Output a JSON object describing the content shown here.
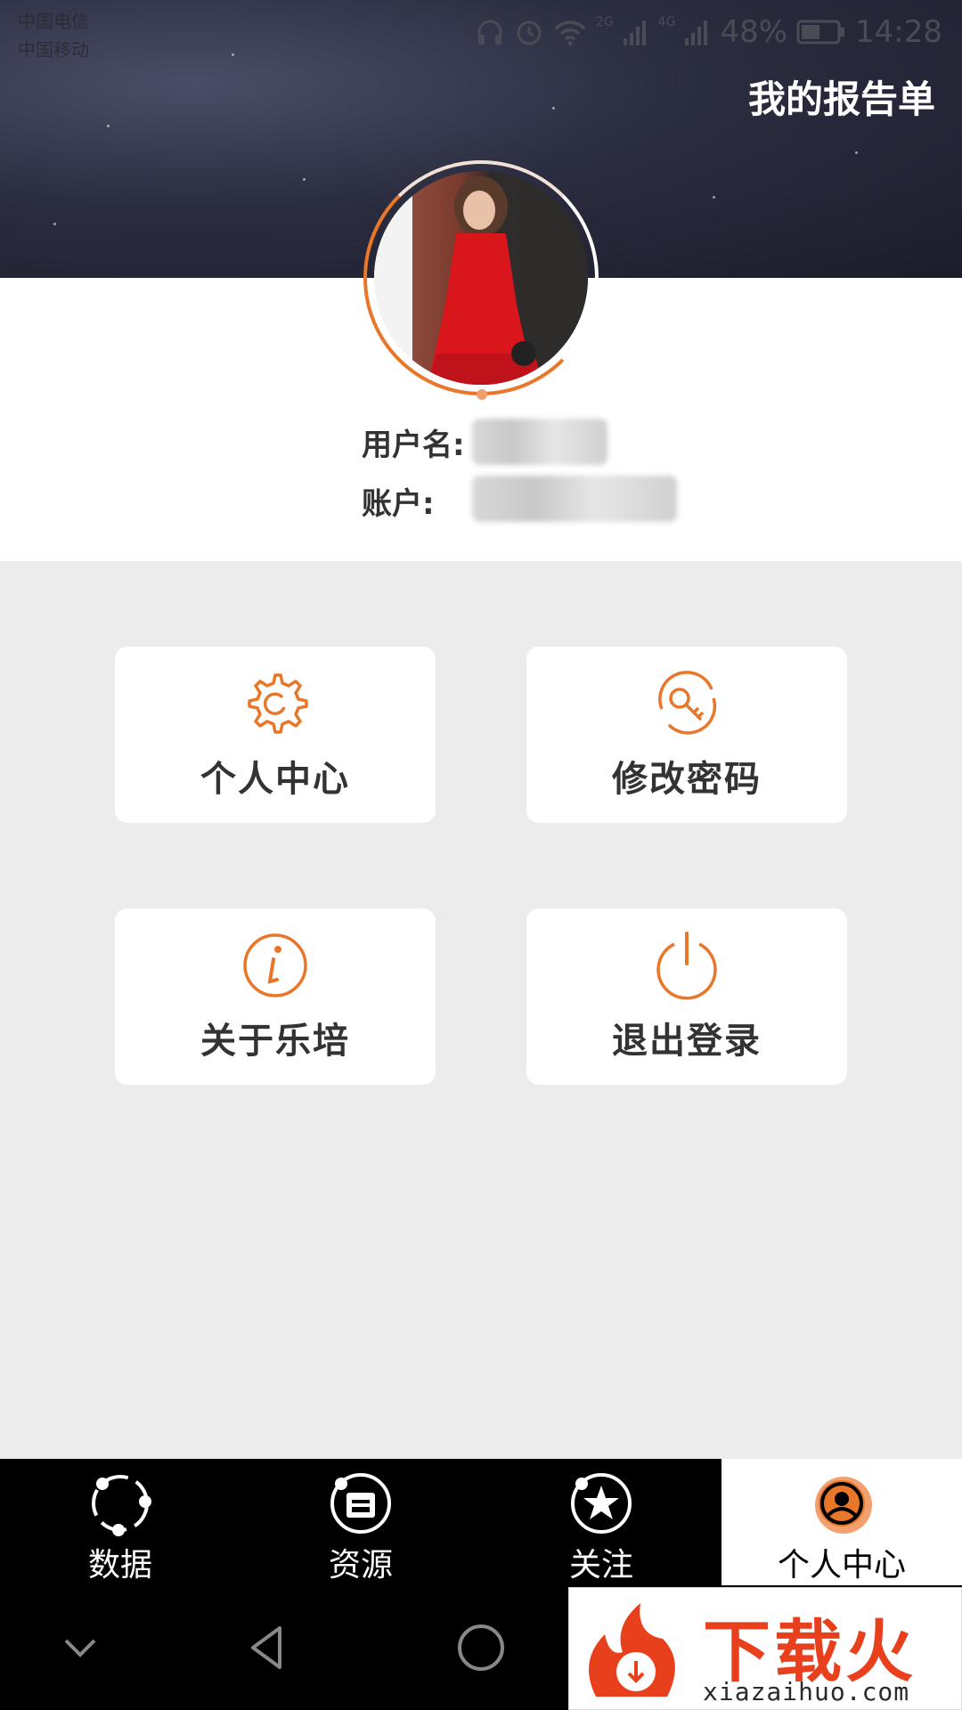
{
  "status_bar": {
    "carrier_1": "中国电信",
    "carrier_2": "中国移动",
    "network_1": "2G",
    "network_2": "4G",
    "battery": "48%",
    "time": "14:28"
  },
  "header": {
    "title": "我的报告单"
  },
  "profile": {
    "username_label": "用户名:",
    "account_label": "账户:"
  },
  "tiles": [
    {
      "label": "个人中心",
      "icon": "gear-icon"
    },
    {
      "label": "修改密码",
      "icon": "key-icon"
    },
    {
      "label": "关于乐培",
      "icon": "info-icon"
    },
    {
      "label": "退出登录",
      "icon": "power-icon"
    }
  ],
  "tabbar": {
    "items": [
      {
        "label": "数据",
        "icon": "data-icon"
      },
      {
        "label": "资源",
        "icon": "resource-icon"
      },
      {
        "label": "关注",
        "icon": "star-icon"
      },
      {
        "label": "个人中心",
        "icon": "person-icon",
        "active": true
      }
    ]
  },
  "watermark": {
    "brand": "下载火",
    "url": "xiazaihuo.com"
  },
  "colors": {
    "accent": "#e8772a",
    "tile_bg": "#ffffff",
    "page_bg": "#ececec",
    "tabbar_bg": "#000000"
  }
}
